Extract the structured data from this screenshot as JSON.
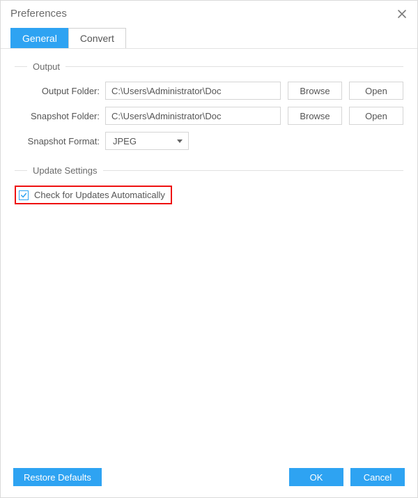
{
  "dialog": {
    "title": "Preferences"
  },
  "tabs": {
    "general": "General",
    "convert": "Convert"
  },
  "output_group": {
    "title": "Output",
    "output_folder_label": "Output Folder:",
    "output_folder_value": "C:\\Users\\Administrator\\Doc",
    "snapshot_folder_label": "Snapshot Folder:",
    "snapshot_folder_value": "C:\\Users\\Administrator\\Doc",
    "snapshot_format_label": "Snapshot Format:",
    "snapshot_format_value": "JPEG",
    "browse": "Browse",
    "open": "Open"
  },
  "update_group": {
    "title": "Update Settings",
    "auto_check_label": "Check for Updates Automatically",
    "auto_check_checked": true
  },
  "footer": {
    "restore": "Restore Defaults",
    "ok": "OK",
    "cancel": "Cancel"
  },
  "colors": {
    "accent": "#2ea3f2",
    "highlight_border": "#e11"
  }
}
